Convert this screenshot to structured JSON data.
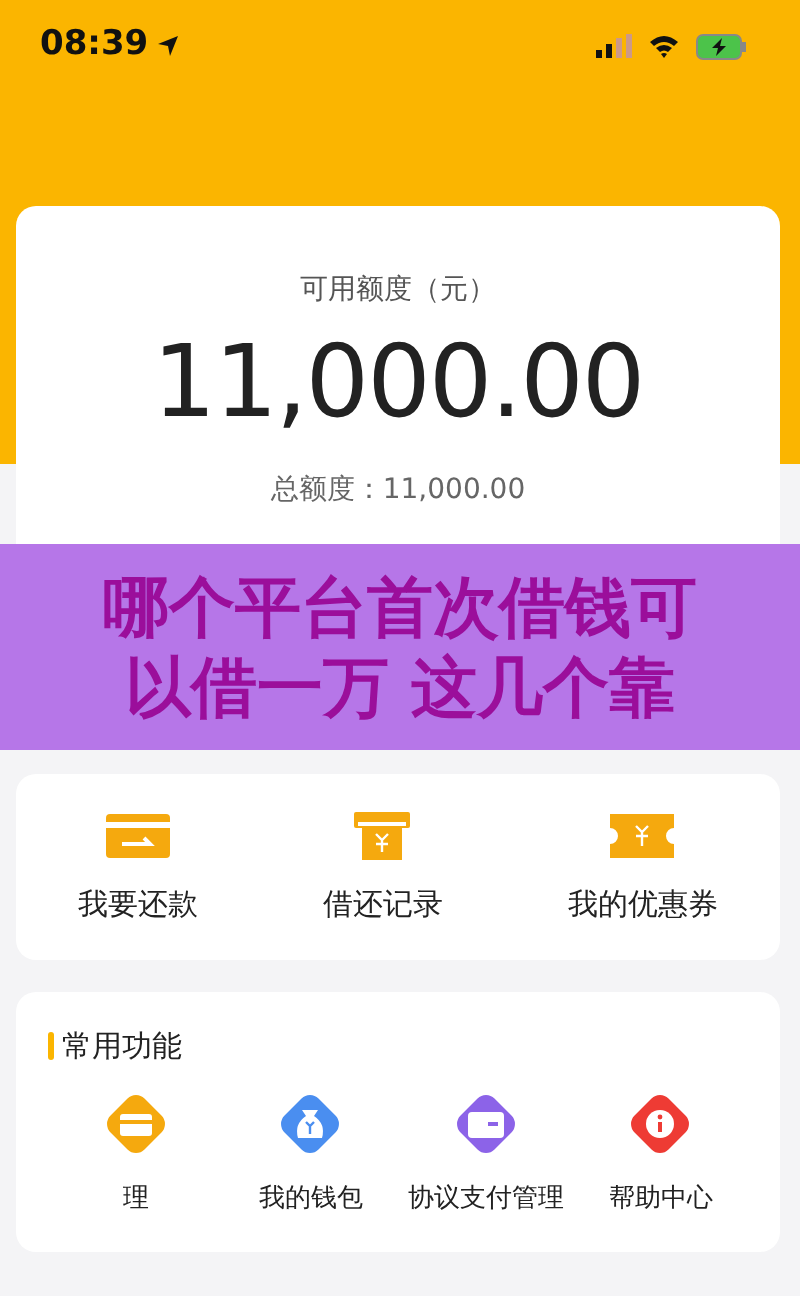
{
  "status_bar": {
    "time": "08:39"
  },
  "credit": {
    "label": "可用额度（元）",
    "amount": "11,000.00",
    "total": "总额度：11,000.00"
  },
  "quick_actions": [
    {
      "kind": "repay",
      "label": "我要还款"
    },
    {
      "kind": "records",
      "label": "借还记录"
    },
    {
      "kind": "coupon",
      "label": "我的优惠券"
    }
  ],
  "common_functions": {
    "title": "常用功能",
    "items": [
      {
        "kind": "card",
        "label": "理",
        "color": "#f5a90e"
      },
      {
        "kind": "wallet",
        "label": "我的钱包",
        "color": "#4a8ef0"
      },
      {
        "kind": "purse",
        "label": "协议支付管理",
        "color": "#8c63e8"
      },
      {
        "kind": "help",
        "label": "帮助中心",
        "color": "#ee3b34"
      }
    ]
  },
  "overlay_banner": {
    "text": "哪个平台首次借钱可以借一万 这几个靠"
  }
}
